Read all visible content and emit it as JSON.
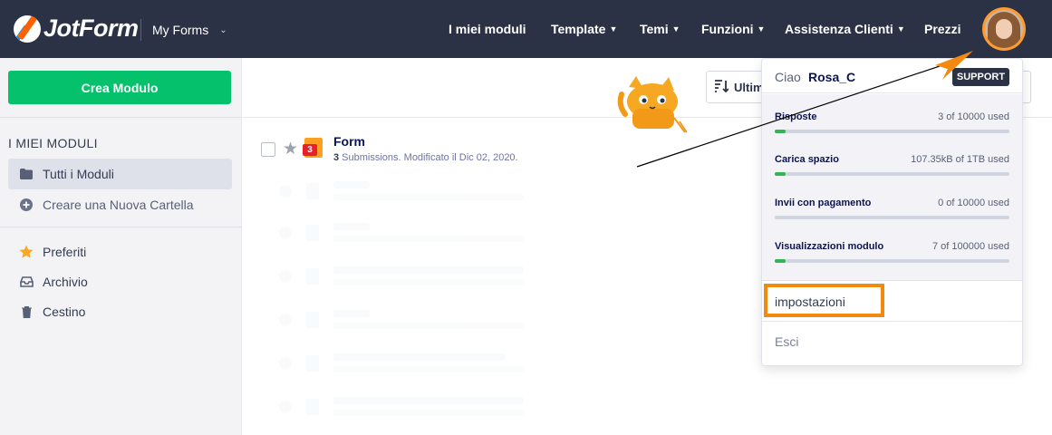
{
  "header": {
    "logo_text": "JotForm",
    "my_forms": "My Forms",
    "nav": [
      "I miei moduli",
      "Template",
      "Temi",
      "Funzioni",
      "Assistenza Clienti",
      "Prezzi"
    ]
  },
  "sidebar": {
    "create_label": "Crea Modulo",
    "heading": "I MIEI MODULI",
    "items": [
      {
        "label": "Tutti i Moduli",
        "icon": "folder-icon"
      },
      {
        "label": "Creare una Nuova Cartella",
        "icon": "plus-circle-icon"
      },
      {
        "label": "Preferiti",
        "icon": "star-icon"
      },
      {
        "label": "Archivio",
        "icon": "inbox-icon"
      },
      {
        "label": "Cestino",
        "icon": "trash-icon"
      }
    ]
  },
  "toolbar": {
    "sort_label": "Ultim"
  },
  "forms": [
    {
      "title": "Form",
      "submissions": "3",
      "meta": " Submissions. Modificato il Dic 02, 2020.",
      "badge": "3"
    }
  ],
  "account": {
    "greeting": "Ciao",
    "username": "Rosa_C",
    "support_badge": "SUPPORT",
    "usage": [
      {
        "label": "Risposte",
        "value": "3 of 10000 used",
        "fraction": 0.0003
      },
      {
        "label": "Carica spazio",
        "value": "107.35kB of 1TB used",
        "fraction": 0.0001
      },
      {
        "label": "Invii con pagamento",
        "value": "0 of 10000 used",
        "fraction": 0
      },
      {
        "label": "Visualizzazioni modulo",
        "value": "7 of 100000 used",
        "fraction": 0.0001
      }
    ],
    "settings_label": "impostazioni",
    "logout_label": "Esci"
  },
  "colors": {
    "topbar": "#2b3245",
    "create_button": "#05c16b",
    "highlight": "#f28a12",
    "usage_fill": "#33b555"
  }
}
